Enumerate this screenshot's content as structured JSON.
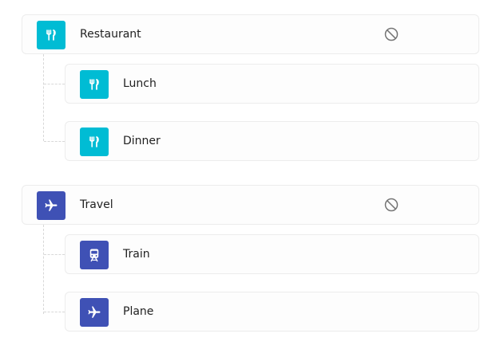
{
  "colors": {
    "restaurant_accent": "#00bcd4",
    "travel_accent": "#3f51b5",
    "border": "#ececec",
    "connector": "#d8d8d8",
    "ban_icon": "#757575"
  },
  "groups": [
    {
      "label": "Restaurant",
      "icon": "fork-knife-icon",
      "action_icon": "ban-icon",
      "children": [
        {
          "label": "Lunch",
          "icon": "fork-knife-icon"
        },
        {
          "label": "Dinner",
          "icon": "fork-knife-icon"
        }
      ]
    },
    {
      "label": "Travel",
      "icon": "airplane-icon",
      "action_icon": "ban-icon",
      "children": [
        {
          "label": "Train",
          "icon": "train-icon"
        },
        {
          "label": "Plane",
          "icon": "airplane-icon"
        }
      ]
    }
  ]
}
